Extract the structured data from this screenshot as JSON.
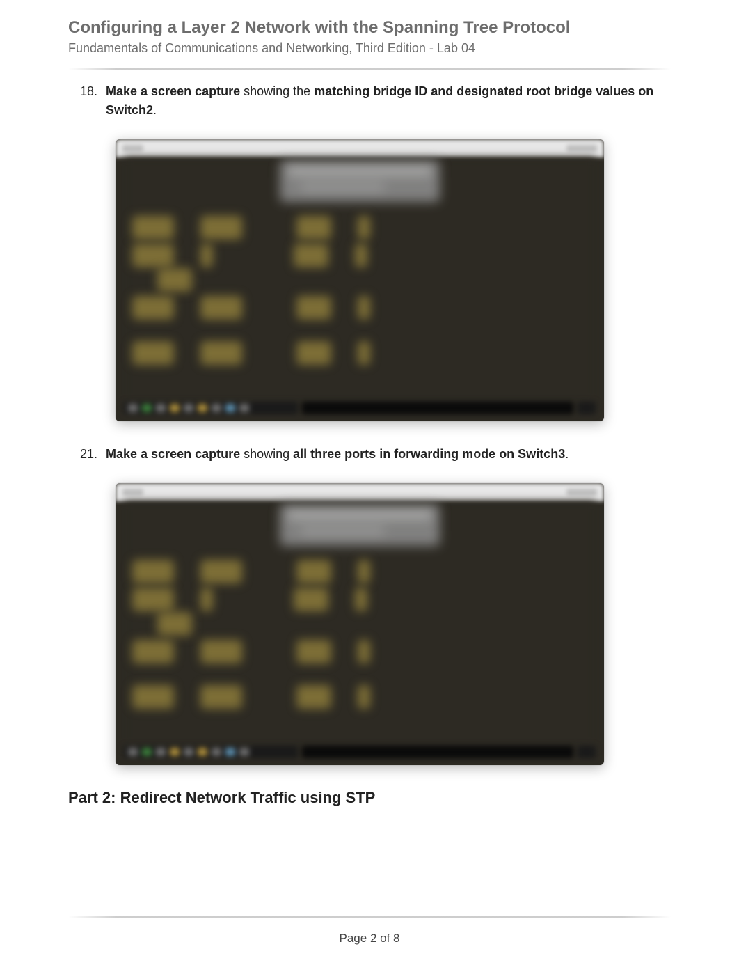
{
  "header": {
    "title": "Configuring a Layer 2 Network with the Spanning Tree Protocol",
    "subtitle": "Fundamentals of Communications and Networking, Third Edition - Lab 04"
  },
  "items": [
    {
      "number": "18.",
      "bold_lead": "Make a screen capture",
      "mid": " showing the ",
      "bold_tail": "matching bridge ID and designated root bridge values on Switch2",
      "period": "."
    },
    {
      "number": "21.",
      "bold_lead": "Make a screen capture",
      "mid": " showing ",
      "bold_tail": "all three ports in forwarding mode on Switch3",
      "period": "."
    }
  ],
  "section_heading": "Part 2: Redirect Network Traffic using STP",
  "footer": {
    "page_label": "Page 2 of 8"
  }
}
